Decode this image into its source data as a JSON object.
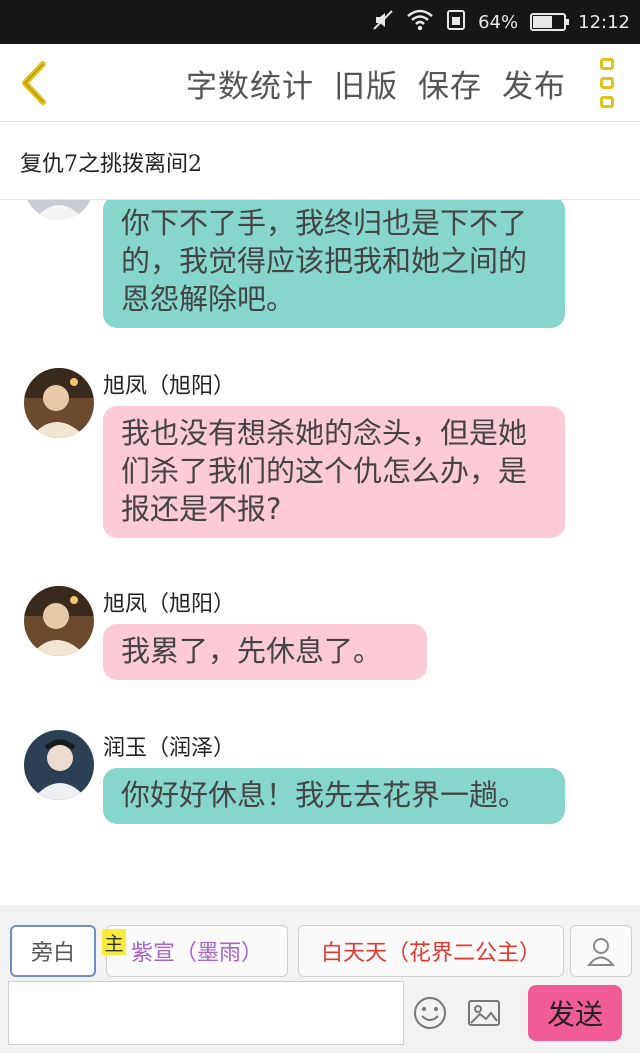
{
  "status_bar": {
    "battery_percent": "64%",
    "battery_level": 0.64,
    "time": "12:12",
    "icons": [
      "mute-icon",
      "wifi-icon",
      "sim-icon",
      "battery-icon"
    ]
  },
  "nav": {
    "back_icon": "chevron-left-icon",
    "word_count": "字数统计",
    "old_version": "旧版",
    "save": "保存",
    "publish": "发布",
    "more_icon": "more-vertical-icon"
  },
  "story": {
    "title": "复仇7之挑拨离间2"
  },
  "messages": [
    {
      "speaker": "",
      "text": "你下不了手，我终归也是下不了的，我觉得应该把我和她之间的恩怨解除吧。",
      "color": "teal"
    },
    {
      "speaker": "旭凤（旭阳）",
      "text": "我也没有想杀她的念头，但是她们杀了我们的这个仇怎么办，是报还是不报?",
      "color": "pink"
    },
    {
      "speaker": "旭凤（旭阳）",
      "text": "我累了，先休息了。",
      "color": "pink"
    },
    {
      "speaker": "润玉（润泽）",
      "text": "你好好休息！我先去花界一趟。",
      "color": "teal"
    }
  ],
  "composer": {
    "narration": "旁白",
    "main_tag": "主",
    "role1": "紫宣（墨雨）",
    "role2": "白天天（花界二公主）",
    "input_value": "",
    "send": "发送"
  },
  "colors": {
    "teal_bubble": "#86d6cc",
    "pink_bubble": "#fdcad7",
    "accent_yellow": "#e3c21d",
    "send_pink": "#f25c96",
    "role1_text": "#a766c6",
    "role2_text": "#e0392f"
  }
}
